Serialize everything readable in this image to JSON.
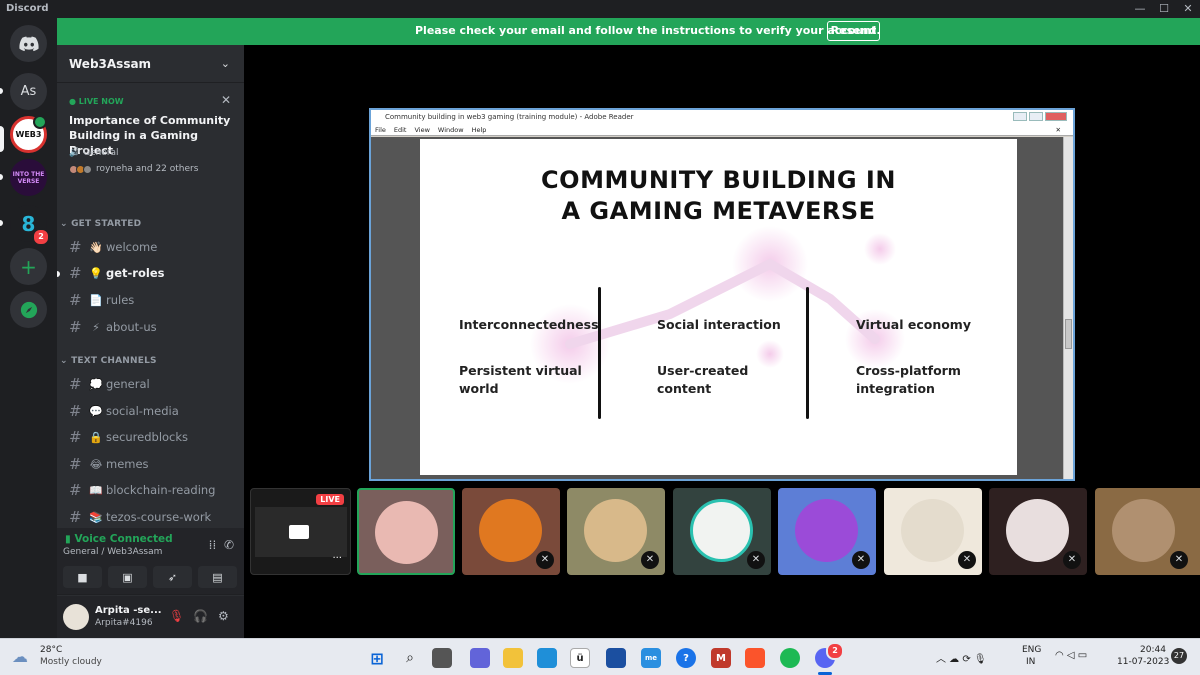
{
  "app": {
    "title": "Discord",
    "win_min": "—",
    "win_max": "☐",
    "win_close": "✕"
  },
  "banner": {
    "message": "Please check your email and follow the instructions to verify your account.",
    "resend": "Resend",
    "color": "#23a559"
  },
  "guilds": [
    {
      "label": "Home",
      "icon": "discord-icon"
    },
    {
      "label": "As",
      "icon": "text"
    },
    {
      "label": "WEB3",
      "icon": "web3-server"
    },
    {
      "label": "INTO THE VERSE",
      "icon": "verse-server"
    },
    {
      "label": "8",
      "icon": "eight-server",
      "badge": "2"
    },
    {
      "label": "+",
      "icon": "add-server-icon"
    },
    {
      "label": "explore",
      "icon": "compass-icon"
    }
  ],
  "sidebar": {
    "server_name": "Web3Assam",
    "event": {
      "live": "LIVE NOW",
      "title": "Importance of Community Building in a Gaming Project",
      "channel": "General",
      "people": "royneha and 22 others"
    },
    "categories": [
      {
        "name": "GET STARTED",
        "channels": [
          {
            "name": "welcome",
            "emoji": "👋🏻"
          },
          {
            "name": "get-roles",
            "emoji": "💡"
          },
          {
            "name": "rules",
            "emoji": "📄"
          },
          {
            "name": "about-us",
            "emoji": "⚡"
          }
        ]
      },
      {
        "name": "TEXT CHANNELS",
        "channels": [
          {
            "name": "general",
            "emoji": "💭"
          },
          {
            "name": "social-media",
            "emoji": "💬"
          },
          {
            "name": "securedblocks",
            "emoji": "🔒"
          },
          {
            "name": "memes",
            "emoji": "😂"
          },
          {
            "name": "blockchain-reading",
            "emoji": "📖"
          },
          {
            "name": "tezos-course-work",
            "emoji": "📚"
          }
        ]
      }
    ]
  },
  "voice": {
    "status": "Voice Connected",
    "location": "General / Web3Assam"
  },
  "user": {
    "name": "Arpita -se...",
    "tag": "Arpita#4196"
  },
  "reader": {
    "title": "Community building in web3 gaming (training module) - Adobe Reader",
    "menu": [
      "File",
      "Edit",
      "View",
      "Window",
      "Help"
    ],
    "slide": {
      "title_line1": "COMMUNITY BUILDING IN",
      "title_line2": "A GAMING METAVERSE",
      "col1": [
        "Interconnectedness",
        "Persistent virtual world"
      ],
      "col2": [
        "Social interaction",
        "User-created content"
      ],
      "col3": [
        "Virtual economy",
        "Cross-platform integration"
      ]
    }
  },
  "live_tag": "LIVE",
  "taskbar": {
    "weather_temp": "28°C",
    "weather_desc": "Mostly cloudy",
    "lang": "ENG",
    "region": "IN",
    "time": "20:44",
    "date": "11-07-2023",
    "notif": "27"
  }
}
